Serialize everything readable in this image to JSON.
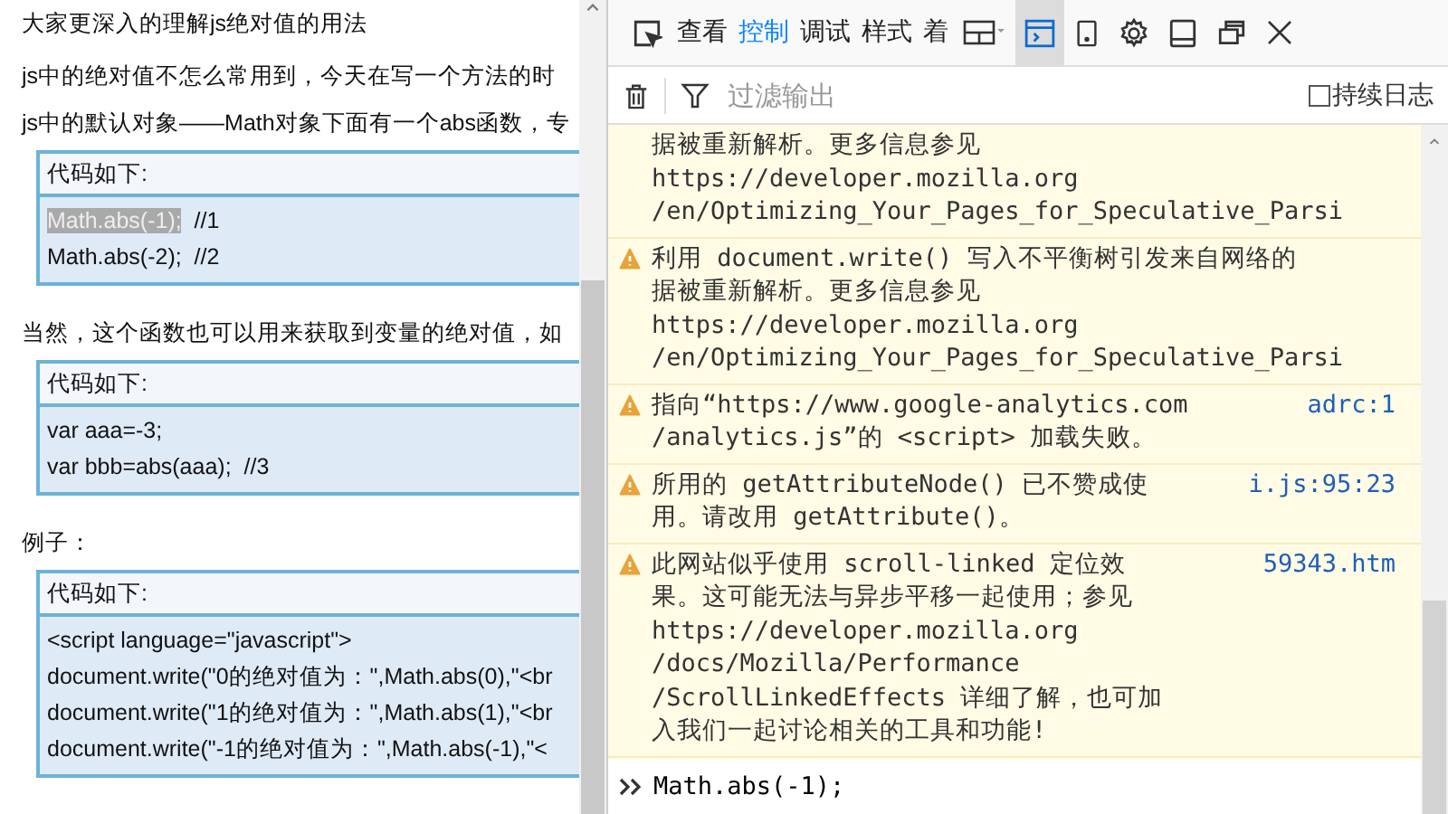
{
  "article": {
    "title": "大家更深入的理解js绝对值的用法",
    "blocks": [
      {
        "kind": "paragraph",
        "text": "js中的绝对值不怎么常用到，今天在写一个方法的时"
      },
      {
        "kind": "paragraph",
        "text": "js中的默认对象——Math对象下面有一个abs函数，专"
      },
      {
        "kind": "code",
        "header": "代码如下:",
        "lines": [
          {
            "segments": [
              {
                "text": "Math.abs(-1);",
                "selected": true
              },
              {
                "text": "  //1",
                "selected": false
              }
            ]
          },
          {
            "segments": [
              {
                "text": "Math.abs(-2);  //2",
                "selected": false
              }
            ]
          }
        ]
      },
      {
        "kind": "paragraph",
        "text": "当然，这个函数也可以用来获取到变量的绝对值，如"
      },
      {
        "kind": "code",
        "header": "代码如下:",
        "lines": [
          {
            "segments": [
              {
                "text": "var aaa=-3;",
                "selected": false
              }
            ]
          },
          {
            "segments": [
              {
                "text": "var bbb=abs(aaa);  //3",
                "selected": false
              }
            ]
          }
        ]
      },
      {
        "kind": "paragraph",
        "text": "例子："
      },
      {
        "kind": "code",
        "header": "代码如下:",
        "lines": [
          {
            "segments": [
              {
                "text": "<script language=\"javascript\">",
                "selected": false
              }
            ]
          },
          {
            "segments": [
              {
                "text": "document.write(\"0的绝对值为：\",Math.abs(0),\"<br",
                "selected": false
              }
            ]
          },
          {
            "segments": [
              {
                "text": "document.write(\"1的绝对值为：\",Math.abs(1),\"<br",
                "selected": false
              }
            ]
          },
          {
            "segments": [
              {
                "text": "document.write(\"-1的绝对值为：\",Math.abs(-1),\"<",
                "selected": false
              }
            ]
          }
        ]
      }
    ]
  },
  "devtools": {
    "tabs": [
      {
        "label": "查看",
        "selected": false
      },
      {
        "label": "控制",
        "selected": true
      },
      {
        "label": "调试",
        "selected": false
      },
      {
        "label": "样式",
        "selected": false
      },
      {
        "label": "着",
        "selected": false
      }
    ],
    "tool_buttons": [
      {
        "kind": "layout",
        "selected": false
      },
      {
        "kind": "split-console",
        "selected": true
      },
      {
        "kind": "phone",
        "selected": false
      },
      {
        "kind": "settings",
        "selected": false
      },
      {
        "kind": "dock",
        "selected": false
      },
      {
        "kind": "window",
        "selected": false
      },
      {
        "kind": "close",
        "selected": false
      }
    ],
    "filter": {
      "placeholder": "过滤输出"
    },
    "persist_log": {
      "label": "持续日志",
      "checked": false
    },
    "messages": [
      {
        "kind": "continuation",
        "lines": [
          "据被重新解析。更多信息参见",
          "https://developer.mozilla.org",
          "/en/Optimizing_Your_Pages_for_Speculative_Parsi"
        ]
      },
      {
        "kind": "warning",
        "lines": [
          "利用 document.write() 写入不平衡树引发来自网络的",
          "据被重新解析。更多信息参见",
          "https://developer.mozilla.org",
          "/en/Optimizing_Your_Pages_for_Speculative_Parsi"
        ]
      },
      {
        "kind": "warning",
        "lines": [
          "指向“https://www.google-analytics.com",
          "/analytics.js”的 <script> 加载失败。"
        ],
        "source": "adrc:1"
      },
      {
        "kind": "warning",
        "lines": [
          "所用的 getAttributeNode() 已不赞成使",
          "用。请改用 getAttribute()。"
        ],
        "source": "i.js:95:23"
      },
      {
        "kind": "warning",
        "lines": [
          "此网站似乎使用 scroll-linked 定位效",
          "果。这可能无法与异步平移一起使用；参见",
          "https://developer.mozilla.org",
          "/docs/Mozilla/Performance",
          "/ScrollLinkedEffects 详细了解，也可加",
          "入我们一起讨论相关的工具和功能!"
        ],
        "source": "59343.htm"
      }
    ],
    "input": {
      "value": "Math.abs(-1);"
    }
  }
}
